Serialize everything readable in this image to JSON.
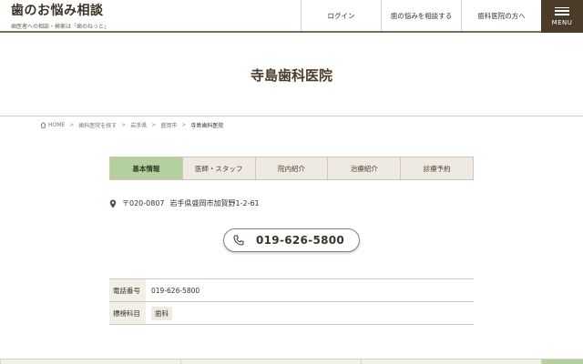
{
  "header": {
    "logo_title": "歯のお悩み相談",
    "logo_subtitle": "歯医者への相談・検索は「歯のねっと」",
    "nav": {
      "login": "ログイン",
      "consult": "歯の悩みを相談する",
      "clinic": "歯科医院の方へ"
    },
    "menu_label": "MENU"
  },
  "hero": {
    "title": "寺島歯科医院"
  },
  "breadcrumb": {
    "home": "HOME",
    "items": [
      "歯科医院を探す",
      "岩手県",
      "盛岡市"
    ],
    "current": "寺島歯科医院"
  },
  "tabs": [
    {
      "label": "基本情報",
      "active": true
    },
    {
      "label": "医師・スタッフ",
      "active": false
    },
    {
      "label": "院内紹介",
      "active": false
    },
    {
      "label": "治療紹介",
      "active": false
    },
    {
      "label": "診療予約",
      "active": false
    }
  ],
  "address": {
    "zip": "〒020-0807",
    "text": "岩手県盛岡市加賀野1-2-61"
  },
  "phone_button": {
    "number": "019-626-5800"
  },
  "info": {
    "rows": [
      {
        "label": "電話番号",
        "value": "019-626-5800"
      },
      {
        "label": "標榜科目",
        "value": "歯科"
      }
    ]
  },
  "colors": {
    "accent_green": "#b5d09f",
    "menu_bg": "#4a3c28",
    "text": "#3a3327"
  },
  "icons": {
    "home": "home-icon",
    "pin": "map-pin-icon",
    "phone": "phone-icon",
    "menu": "hamburger-icon"
  }
}
